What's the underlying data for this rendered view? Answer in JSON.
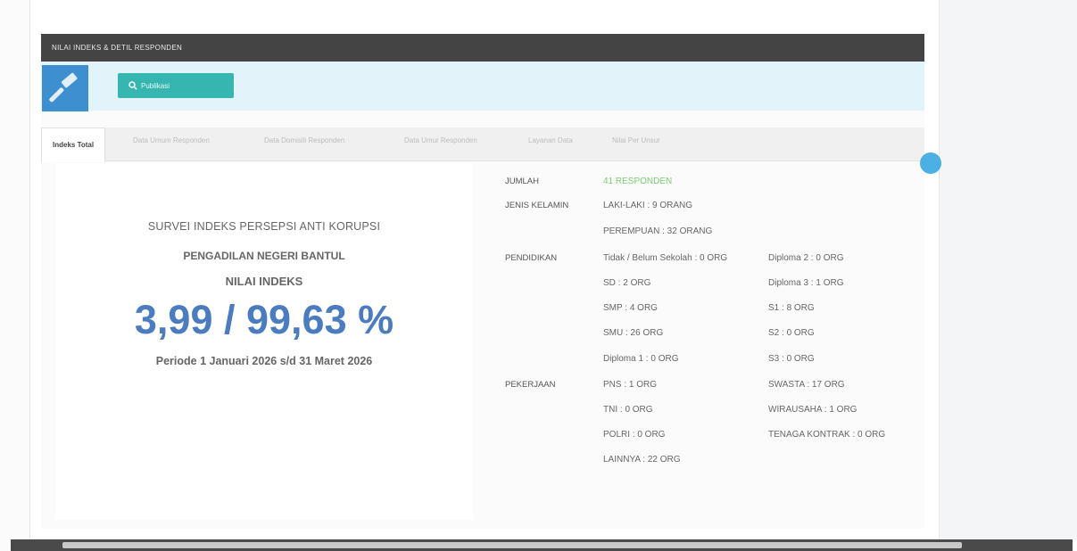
{
  "panel": {
    "header_title": "NILAI INDEKS & DETIL RESPONDEN",
    "search_button_label": "Publikasi"
  },
  "tabs": [
    {
      "label": "Indeks Total"
    },
    {
      "label": "Data Umum Responden"
    },
    {
      "label": "Data Domisili Responden"
    },
    {
      "label": "Data Umur Responden"
    },
    {
      "label": "Layanan Data"
    },
    {
      "label": "Nilai Per Unsur"
    }
  ],
  "summary": {
    "survey_title": "SURVEI INDEKS PERSEPSI ANTI KORUPSI",
    "court_name": "PENGADILAN NEGERI BANTUL",
    "index_label": "NILAI INDEKS",
    "index_value": "3,99 / 99,63 %",
    "period": "Periode 1 Januari 2026 s/d 31 Maret 2026"
  },
  "respondents": {
    "total_label": "JUMLAH",
    "total_value": "41 RESPONDEN",
    "gender_label": "JENIS KELAMIN",
    "gender": [
      "LAKI-LAKI : 9 ORANG",
      "PEREMPUAN : 32 ORANG"
    ],
    "education_label": "PENDIDIKAN",
    "education_col1": [
      "Tidak / Belum Sekolah : 0 ORG",
      "SD : 2 ORG",
      "SMP : 4 ORG",
      "SMU : 26 ORG",
      "Diploma 1 : 0 ORG"
    ],
    "education_col2": [
      "Diploma 2 : 0 ORG",
      "Diploma 3 : 1 ORG",
      "S1 : 8 ORG",
      "S2 : 0 ORG",
      "S3 : 0 ORG"
    ],
    "occupation_label": "PEKERJAAN",
    "occupation_col1": [
      "PNS : 1 ORG",
      "TNI : 0 ORG",
      "POLRI : 0 ORG",
      "LAINNYA : 22 ORG"
    ],
    "occupation_col2": [
      "SWASTA : 17 ORG",
      "WIRAUSAHA : 1 ORG",
      "TENAGA KONTRAK : 0 ORG"
    ]
  },
  "colors": {
    "header_bg": "#444444",
    "hero_bg": "#e2f3f9",
    "gavel_box": "#3d8fcf",
    "search_button": "#37b5b0",
    "index_value": "#4b7cbf",
    "responden_green": "#7dcc78",
    "scroll_circle": "#4bb0e4"
  },
  "icons": {
    "gavel": "gavel-icon",
    "search": "search-icon"
  }
}
